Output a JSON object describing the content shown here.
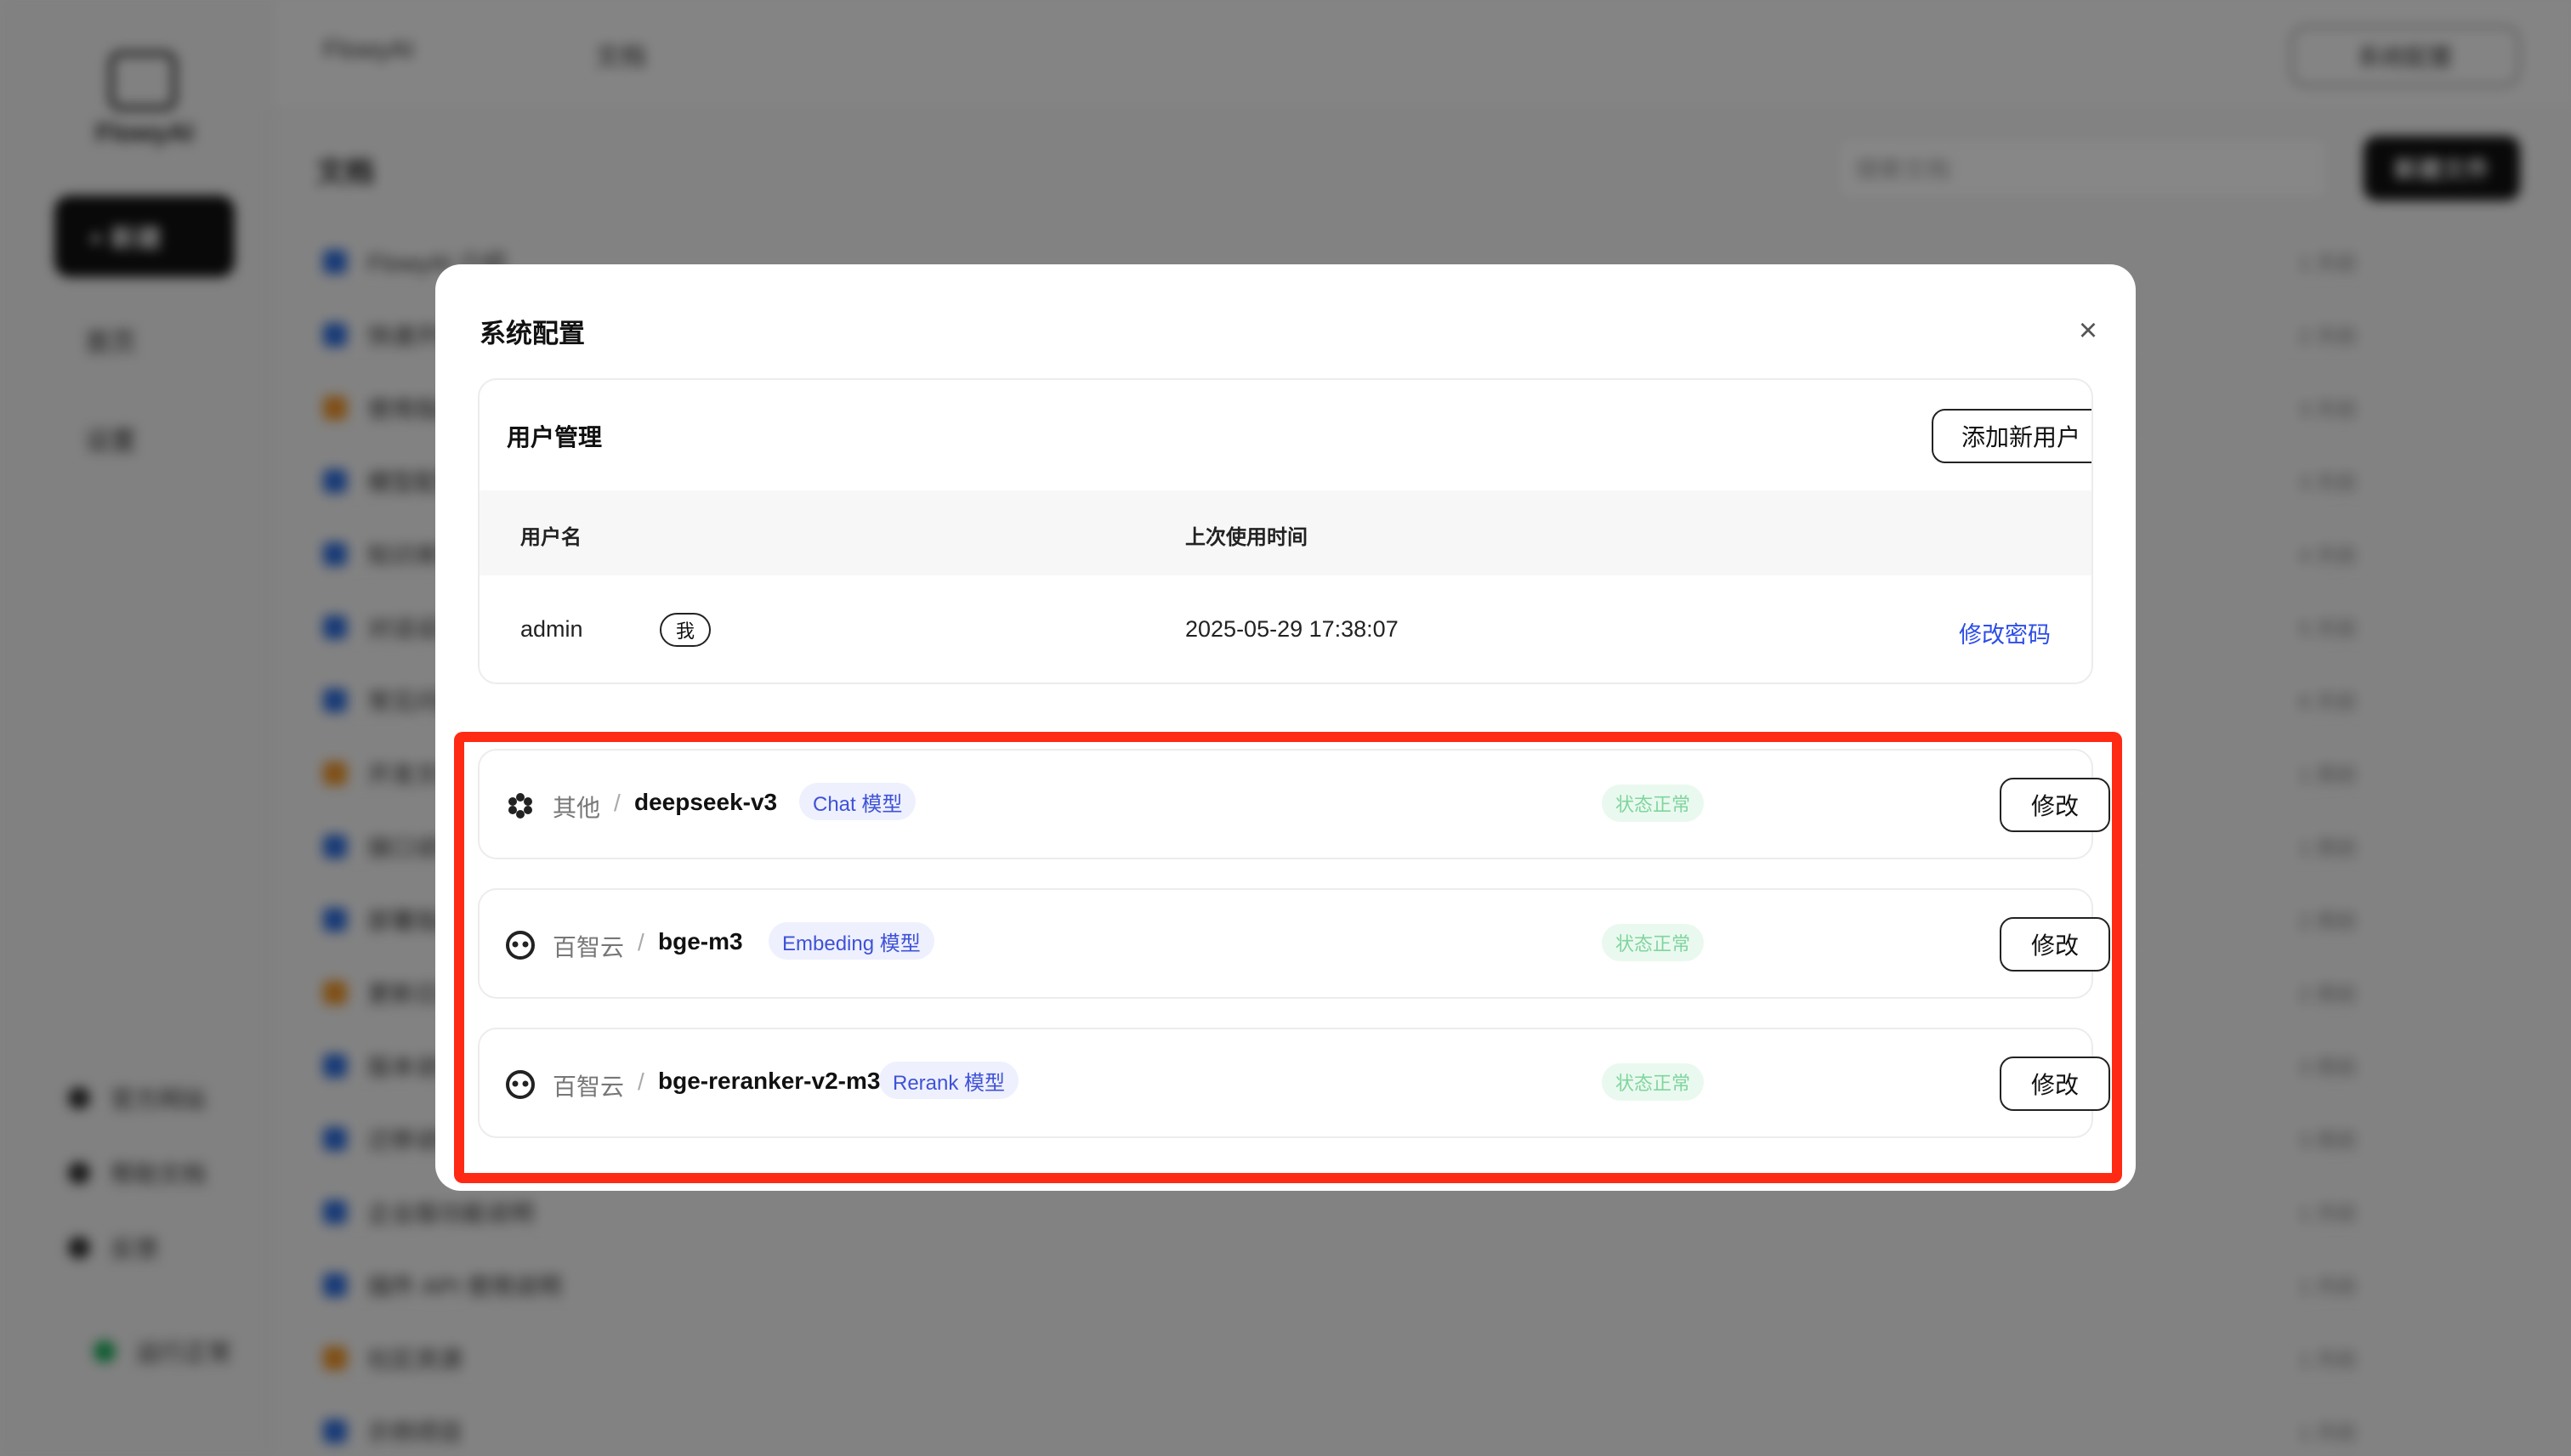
{
  "background": {
    "brand": "FlowyAI",
    "new_button": "+ 新建",
    "side_items": [
      "首页",
      "设置"
    ],
    "side_bottom": [
      "官方网站",
      "帮助文档",
      "反馈"
    ],
    "status_text": "运行正常",
    "breadcrumb": [
      "FlowyAI",
      "文档"
    ],
    "top_button": "系统配置",
    "toolbar_title": "文档",
    "search_placeholder": "搜索文档",
    "create_button": "新建文件",
    "list_rows": [
      {
        "name": "FlowyAI 介绍",
        "meta": "1 天前",
        "folder": false
      },
      {
        "name": "快速开始",
        "meta": "2 天前",
        "folder": false
      },
      {
        "name": "使用指南",
        "meta": "3 天前",
        "folder": true
      },
      {
        "name": "模型配置",
        "meta": "3 天前",
        "folder": false
      },
      {
        "name": "知识库管理",
        "meta": "4 天前",
        "folder": false
      },
      {
        "name": "对话设置",
        "meta": "5 天前",
        "folder": false
      },
      {
        "name": "常见问题",
        "meta": "6 天前",
        "folder": false
      },
      {
        "name": "开发文档",
        "meta": "1 周前",
        "folder": true
      },
      {
        "name": "接口说明",
        "meta": "1 周前",
        "folder": false
      },
      {
        "name": "部署指南",
        "meta": "2 周前",
        "folder": false
      },
      {
        "name": "更新日志",
        "meta": "2 周前",
        "folder": true
      },
      {
        "name": "版本说明",
        "meta": "3 周前",
        "folder": false
      },
      {
        "name": "迁移说明",
        "meta": "3 周前",
        "folder": false
      },
      {
        "name": "企业版功能说明",
        "meta": "1 月前",
        "folder": false
      },
      {
        "name": "插件 API 使用说明",
        "meta": "1 月前",
        "folder": false
      },
      {
        "name": "社区资源",
        "meta": "1 月前",
        "folder": true
      },
      {
        "name": "示例项目",
        "meta": "1 月前",
        "folder": false
      }
    ]
  },
  "modal": {
    "title": "系统配置",
    "close_icon": "×",
    "user_section": {
      "title": "用户管理",
      "add_button": "添加新用户",
      "columns": [
        "用户名",
        "上次使用时间"
      ],
      "rows": [
        {
          "username": "admin",
          "badge": "我",
          "last_used": "2025-05-29 17:38:07",
          "action": "修改密码"
        }
      ]
    },
    "models": [
      {
        "icon": "hexagon-cluster-icon",
        "provider": "其他",
        "separator": "/",
        "name": "deepseek-v3",
        "tag": "Chat 模型",
        "status": "状态正常",
        "action": "修改"
      },
      {
        "icon": "baidu-face-icon",
        "provider": "百智云",
        "separator": "/",
        "name": "bge-m3",
        "tag": "Embeding 模型",
        "status": "状态正常",
        "action": "修改"
      },
      {
        "icon": "baidu-face-icon",
        "provider": "百智云",
        "separator": "/",
        "name": "bge-reranker-v2-m3",
        "tag": "Rerank 模型",
        "status": "状态正常",
        "action": "修改"
      }
    ]
  },
  "colors": {
    "highlight": "#ff2a14",
    "link": "#2c4de8",
    "tag_bg": "#eef0fd",
    "tag_text": "#3f52d8",
    "status_bg": "#eaf9ef",
    "status_text": "#7fd59e"
  }
}
